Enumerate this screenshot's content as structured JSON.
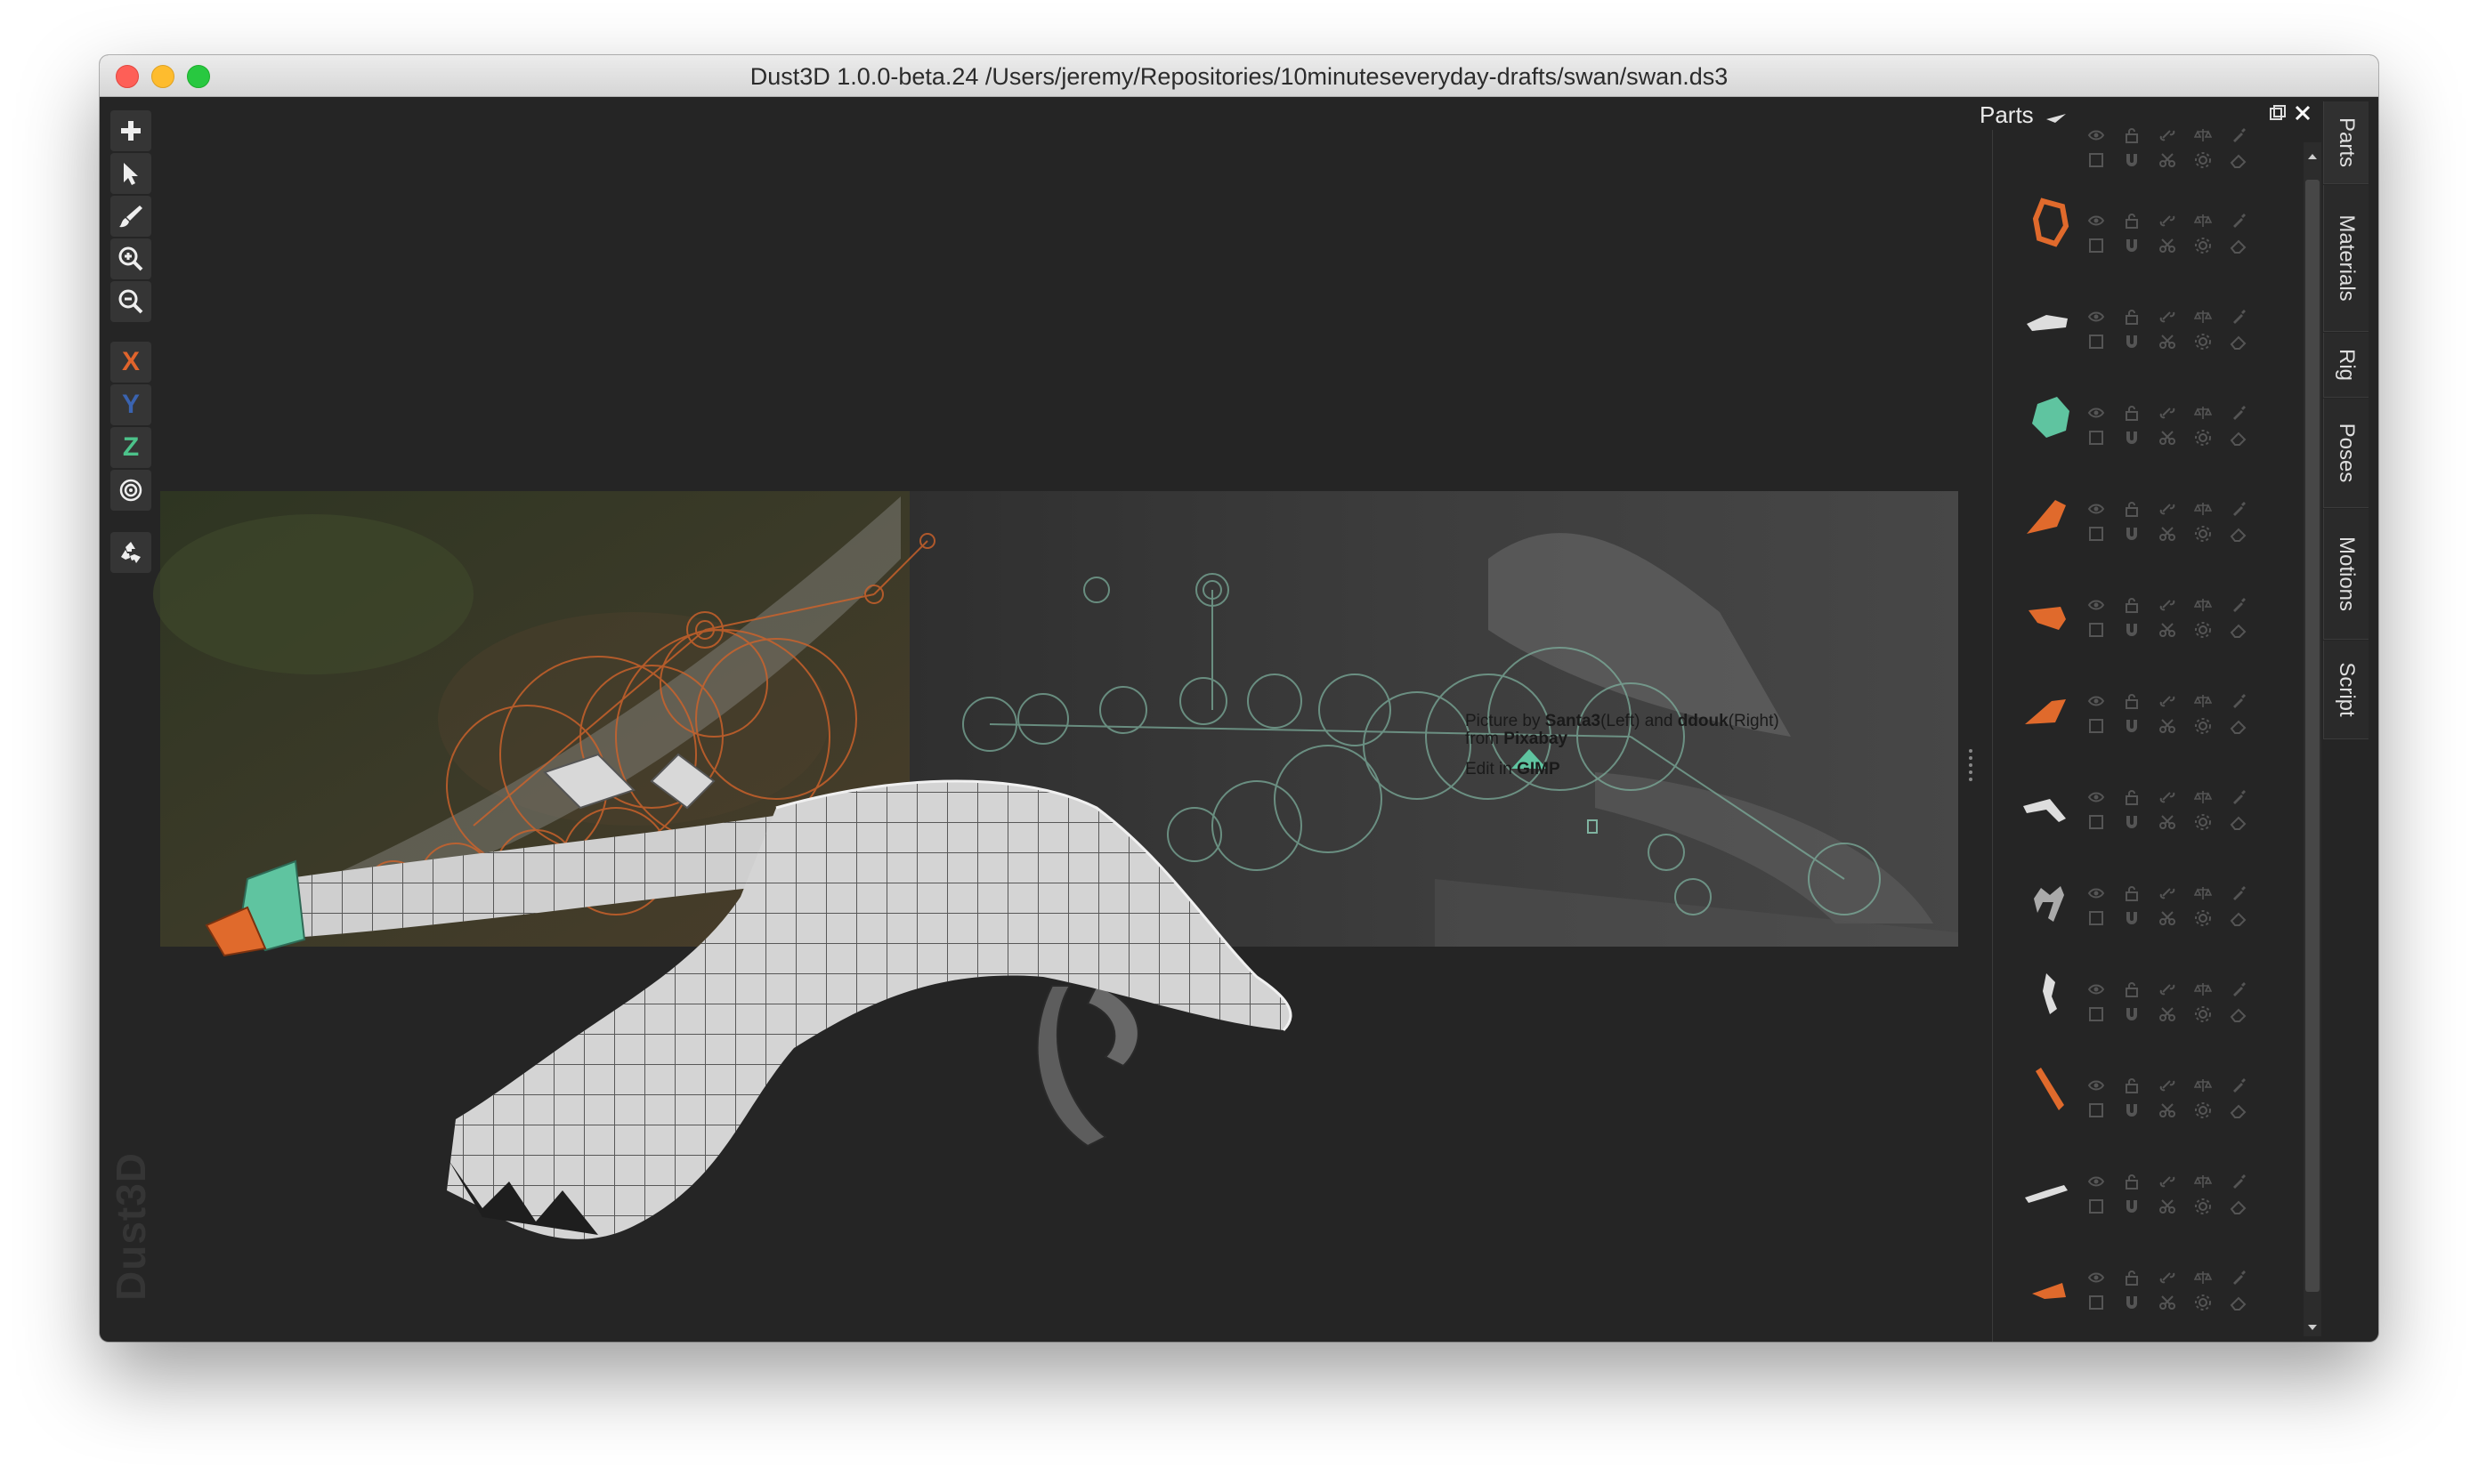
{
  "window": {
    "title": "Dust3D 1.0.0-beta.24 /Users/jeremy/Repositories/10minuteseveryday-drafts/swan/swan.ds3"
  },
  "toolbar": {
    "tools": [
      {
        "name": "add-tool",
        "icon": "plus-icon"
      },
      {
        "name": "select-tool",
        "icon": "pointer-arrow-icon"
      },
      {
        "name": "paint-tool",
        "icon": "brush-icon"
      },
      {
        "name": "zoom-in-tool",
        "icon": "zoom-in-icon"
      },
      {
        "name": "zoom-out-tool",
        "icon": "zoom-out-icon"
      }
    ],
    "axis": {
      "x_label": "X",
      "y_label": "Y",
      "z_label": "Z"
    },
    "radius_icon": "radius-target-icon",
    "regenerate_icon": "recycle-icon"
  },
  "brand": "Dust3D",
  "viewport": {
    "credit_line1_prefix": "Picture by ",
    "credit_author1": "Santa3",
    "credit_side1": "(Left) and ",
    "credit_author2": "ddouk",
    "credit_side2": "(Right)",
    "credit_line2_prefix": "from ",
    "credit_site": "Pixabay",
    "credit_line3_prefix": "Edit in ",
    "credit_tool": "GIMP"
  },
  "parts_panel": {
    "title": "Parts",
    "parts": [
      {
        "shape": "wedge",
        "color": "#dddddd"
      },
      {
        "shape": "hexring",
        "color": "#e06a2c"
      },
      {
        "shape": "slab",
        "color": "#dddddd"
      },
      {
        "shape": "gem",
        "color": "#5fc4a0"
      },
      {
        "shape": "fin",
        "color": "#e06a2c"
      },
      {
        "shape": "block",
        "color": "#e06a2c"
      },
      {
        "shape": "fin2",
        "color": "#e06a2c"
      },
      {
        "shape": "bent",
        "color": "#dddddd"
      },
      {
        "shape": "legs",
        "color": "#aaaaaa"
      },
      {
        "shape": "curl",
        "color": "#dddddd"
      },
      {
        "shape": "stick",
        "color": "#e06a2c"
      },
      {
        "shape": "flat",
        "color": "#dddddd"
      },
      {
        "shape": "tip",
        "color": "#e06a2c"
      }
    ]
  },
  "side_tabs": [
    "Parts",
    "Materials",
    "Rig",
    "Poses",
    "Motions",
    "Script"
  ],
  "colors": {
    "accent_orange": "#e06a2c",
    "accent_green": "#5fc4a0",
    "axis_x": "#e0642c",
    "axis_y": "#3a63b0",
    "axis_z": "#4cc28a"
  }
}
